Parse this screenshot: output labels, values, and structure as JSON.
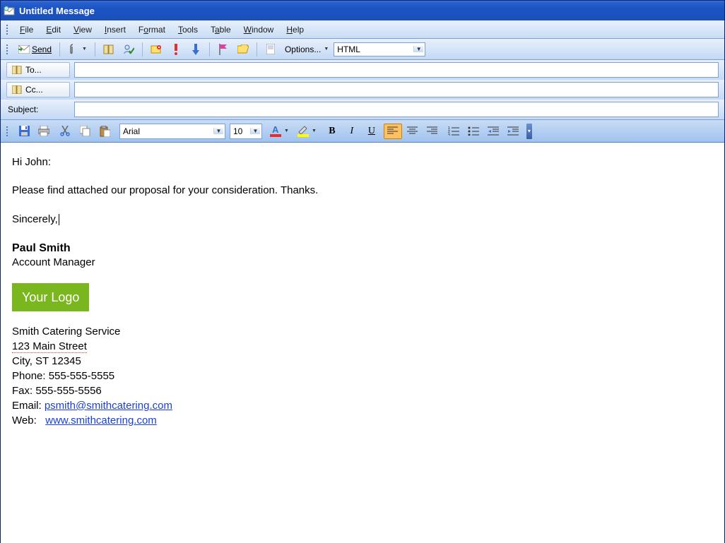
{
  "window": {
    "title": "Untitled Message"
  },
  "menu": {
    "file": "File",
    "edit": "Edit",
    "view": "View",
    "insert": "Insert",
    "format": "Format",
    "tools": "Tools",
    "table": "Table",
    "window": "Window",
    "help": "Help"
  },
  "toolbar": {
    "send": "Send",
    "options": "Options...",
    "format_combo": "HTML"
  },
  "fields": {
    "to_label": "To...",
    "to_value": "",
    "cc_label": "Cc...",
    "cc_value": "",
    "subject_label": "Subject:",
    "subject_value": ""
  },
  "format": {
    "font": "Arial",
    "size": "10"
  },
  "body": {
    "greeting": "Hi John:",
    "para1": "Please find attached our proposal for your consideration.  Thanks.",
    "closing": "Sincerely,",
    "sig_name": "Paul Smith",
    "sig_title": "Account Manager",
    "logo_text": "Your Logo",
    "company": "Smith Catering Service",
    "addr1": "123 Main Street",
    "addr2": "City, ST 12345",
    "phone_label": "Phone: ",
    "phone": "555-555-5555",
    "fax_label": "Fax: ",
    "fax": "555-555-5556",
    "email_label": "Email: ",
    "email": "psmith@smithcatering.com",
    "web_label": "Web:   ",
    "web": "www.smithcatering.com"
  }
}
